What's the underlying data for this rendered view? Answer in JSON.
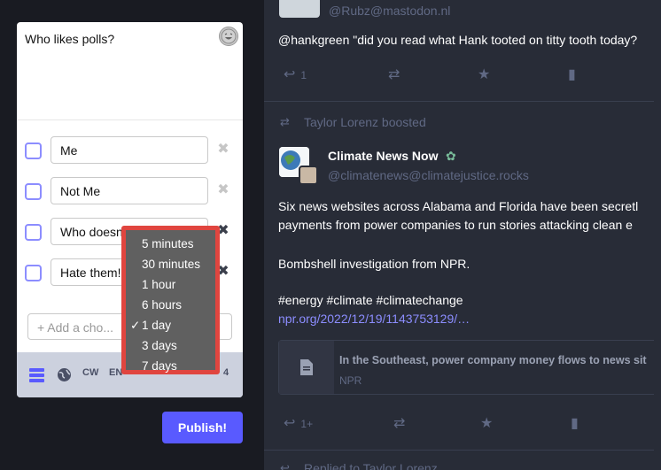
{
  "composer": {
    "text": "Who likes polls?",
    "emoji_icon": "laughing-emoji-icon",
    "poll_options": [
      "Me",
      "Not Me",
      "Who doesn't",
      "Hate them!"
    ],
    "add_choice_placeholder": "+ Add a cho...",
    "toolbar": {
      "cw_label": "CW",
      "lang_label": "EN",
      "char_count": "4"
    },
    "publish_label": "Publish!"
  },
  "duration_menu": {
    "options": [
      "5 minutes",
      "30 minutes",
      "1 hour",
      "6 hours",
      "1 day",
      "3 days",
      "7 days"
    ],
    "selected": "1 day",
    "check_glyph": "✓"
  },
  "feed": {
    "post1": {
      "handle": "@Rubz@mastodon.nl",
      "text": "@hankgreen \"did you read what Hank tooted on titty tooth today?",
      "reply_count": "1"
    },
    "post2": {
      "boost_label": "Taylor Lorenz boosted",
      "author": "Climate News Now",
      "handle": "@climatenews@climatejustice.rocks",
      "text1": "Six news websites across Alabama and Florida have been secretl",
      "text2": "payments from power companies to run stories attacking clean e",
      "text3": "Bombshell investigation from NPR.",
      "hashtags": "#energy #climate #climatechange",
      "link": "npr.org/2022/12/19/1143753129/…",
      "card_title": "In the Southeast, power company money flows to news sit",
      "card_source": "NPR",
      "reply_count": "1+"
    },
    "post3": {
      "reply_label": "Replied to Taylor Lorenz"
    }
  }
}
